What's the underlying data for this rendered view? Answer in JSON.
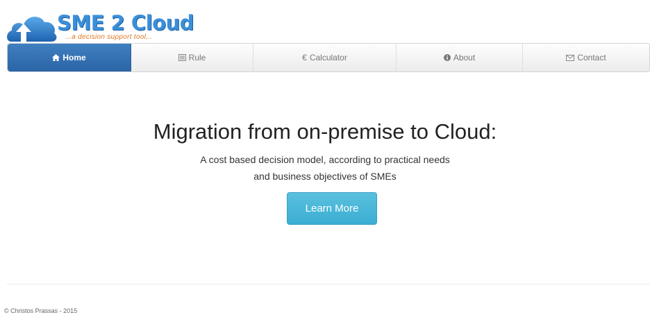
{
  "brand": {
    "name": "SME 2 Cloud",
    "tagline": "...a decision support tool...",
    "colors": {
      "primary": "#3a8fd9",
      "tagline": "#e0751f"
    }
  },
  "nav": {
    "items": [
      {
        "label": "Home",
        "icon": "home-icon",
        "active": true
      },
      {
        "label": "Rule",
        "icon": "list-icon",
        "active": false
      },
      {
        "label": "Calculator",
        "icon": "euro-icon",
        "active": false
      },
      {
        "label": "About",
        "icon": "info-icon",
        "active": false
      },
      {
        "label": "Contact",
        "icon": "envelope-icon",
        "active": false
      }
    ],
    "colors": {
      "active_bg": "#2b65a6"
    }
  },
  "hero": {
    "title": "Migration from on-premise to Cloud:",
    "subtitle_line1": "A cost based decision model, according to practical needs",
    "subtitle_line2": "and business objectives of SMEs",
    "button_label": "Learn More",
    "colors": {
      "button_bg": "#5bc0de"
    }
  },
  "footer": {
    "text": "© Christos Prassas - 2015"
  }
}
